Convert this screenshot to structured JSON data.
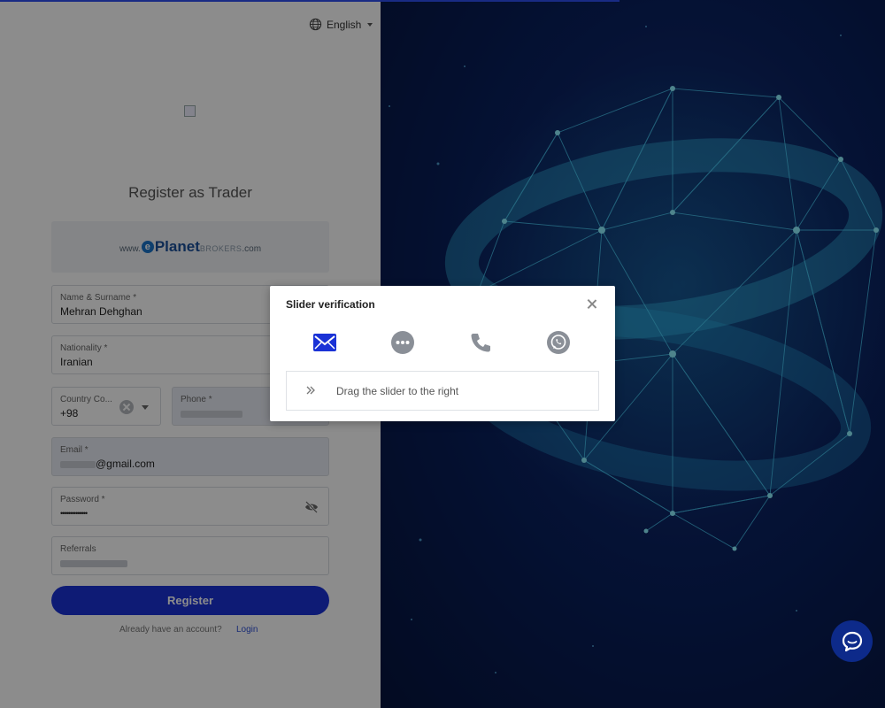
{
  "language": {
    "label": "English",
    "icon": "globe-icon"
  },
  "form": {
    "title": "Register as Trader",
    "brand": {
      "prefix": "www.",
      "letter": "e",
      "name": "Planet",
      "suffix": "BROKERS",
      "tld": ".com"
    },
    "fields": {
      "name": {
        "label": "Name & Surname *",
        "value": "Mehran Dehghan"
      },
      "nationality": {
        "label": "Nationality *",
        "value": "Iranian"
      },
      "country_code": {
        "label": "Country Co...",
        "value": "+98"
      },
      "phone": {
        "label": "Phone *",
        "value": ""
      },
      "email": {
        "label": "Email *",
        "value": "@gmail.com"
      },
      "password": {
        "label": "Password *",
        "value": "••••••••••••••"
      },
      "referrals": {
        "label": "Referrals",
        "value": ""
      }
    },
    "register_label": "Register",
    "already_text": "Already have an account?",
    "login_label": "Login"
  },
  "modal": {
    "title": "Slider verification",
    "methods": [
      "email-icon",
      "sms-icon",
      "phone-icon",
      "whatsapp-icon"
    ],
    "slider_text": "Drag the slider to the right"
  },
  "colors": {
    "primary": "#1a32d6",
    "link": "#2c4fd6",
    "chat": "#0d2a8a"
  }
}
